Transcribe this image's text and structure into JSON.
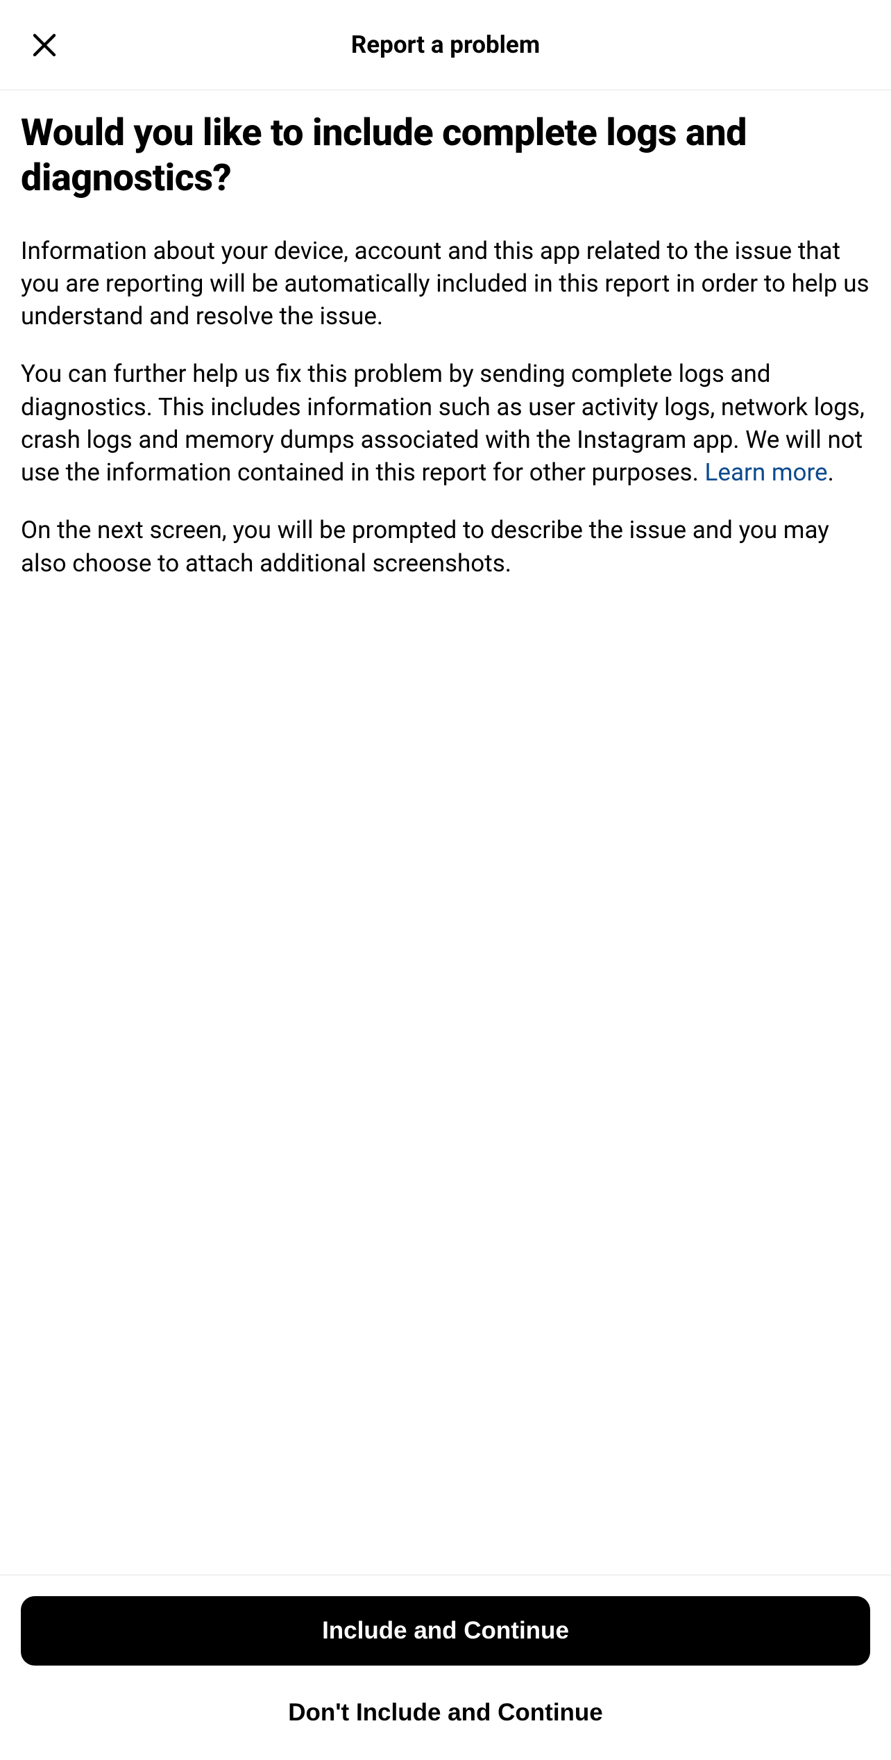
{
  "header": {
    "title": "Report a problem"
  },
  "main": {
    "heading": "Would you like to include complete logs and diagnostics?",
    "paragraph1": "Information about your device, account and this app related to the issue that you are reporting will be automatically included in this report in order to help us understand and resolve the issue.",
    "paragraph2_part1": "You can further help us fix this problem by sending complete logs and diagnostics. This includes information such as user activity logs, network logs, crash logs and memory dumps associated with the Instagram app. We will not use the information contained in this report for other purposes. ",
    "learn_more_text": "Learn more",
    "paragraph2_part2": ".",
    "paragraph3": "On the next screen, you will be prompted to describe the issue and you may also choose to attach additional screenshots."
  },
  "footer": {
    "primary_button": "Include and Continue",
    "secondary_button": "Don't Include and Continue"
  }
}
